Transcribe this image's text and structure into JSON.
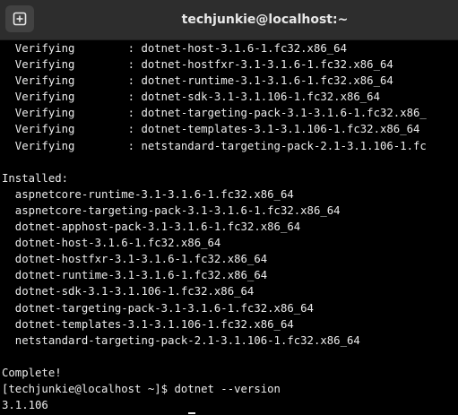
{
  "window": {
    "title": "techjunkie@localhost:~"
  },
  "icons": {
    "new_tab": "new-tab-icon"
  },
  "colors": {
    "titlebar_bg": "#2d2d2d",
    "terminal_bg": "#000000",
    "terminal_fg": "#ececec"
  },
  "terminal": {
    "lines": [
      "  Verifying        : dotnet-host-3.1.6-1.fc32.x86_64",
      "  Verifying        : dotnet-hostfxr-3.1-3.1.6-1.fc32.x86_64",
      "  Verifying        : dotnet-runtime-3.1-3.1.6-1.fc32.x86_64",
      "  Verifying        : dotnet-sdk-3.1-3.1.106-1.fc32.x86_64",
      "  Verifying        : dotnet-targeting-pack-3.1-3.1.6-1.fc32.x86_",
      "  Verifying        : dotnet-templates-3.1-3.1.106-1.fc32.x86_64",
      "  Verifying        : netstandard-targeting-pack-2.1-3.1.106-1.fc",
      "",
      "Installed:",
      "  aspnetcore-runtime-3.1-3.1.6-1.fc32.x86_64",
      "  aspnetcore-targeting-pack-3.1-3.1.6-1.fc32.x86_64",
      "  dotnet-apphost-pack-3.1-3.1.6-1.fc32.x86_64",
      "  dotnet-host-3.1.6-1.fc32.x86_64",
      "  dotnet-hostfxr-3.1-3.1.6-1.fc32.x86_64",
      "  dotnet-runtime-3.1-3.1.6-1.fc32.x86_64",
      "  dotnet-sdk-3.1-3.1.106-1.fc32.x86_64",
      "  dotnet-targeting-pack-3.1-3.1.6-1.fc32.x86_64",
      "  dotnet-templates-3.1-3.1.106-1.fc32.x86_64",
      "  netstandard-targeting-pack-2.1-3.1.106-1.fc32.x86_64",
      "",
      "Complete!",
      "[techjunkie@localhost ~]$ dotnet --version",
      "3.1.106"
    ]
  }
}
